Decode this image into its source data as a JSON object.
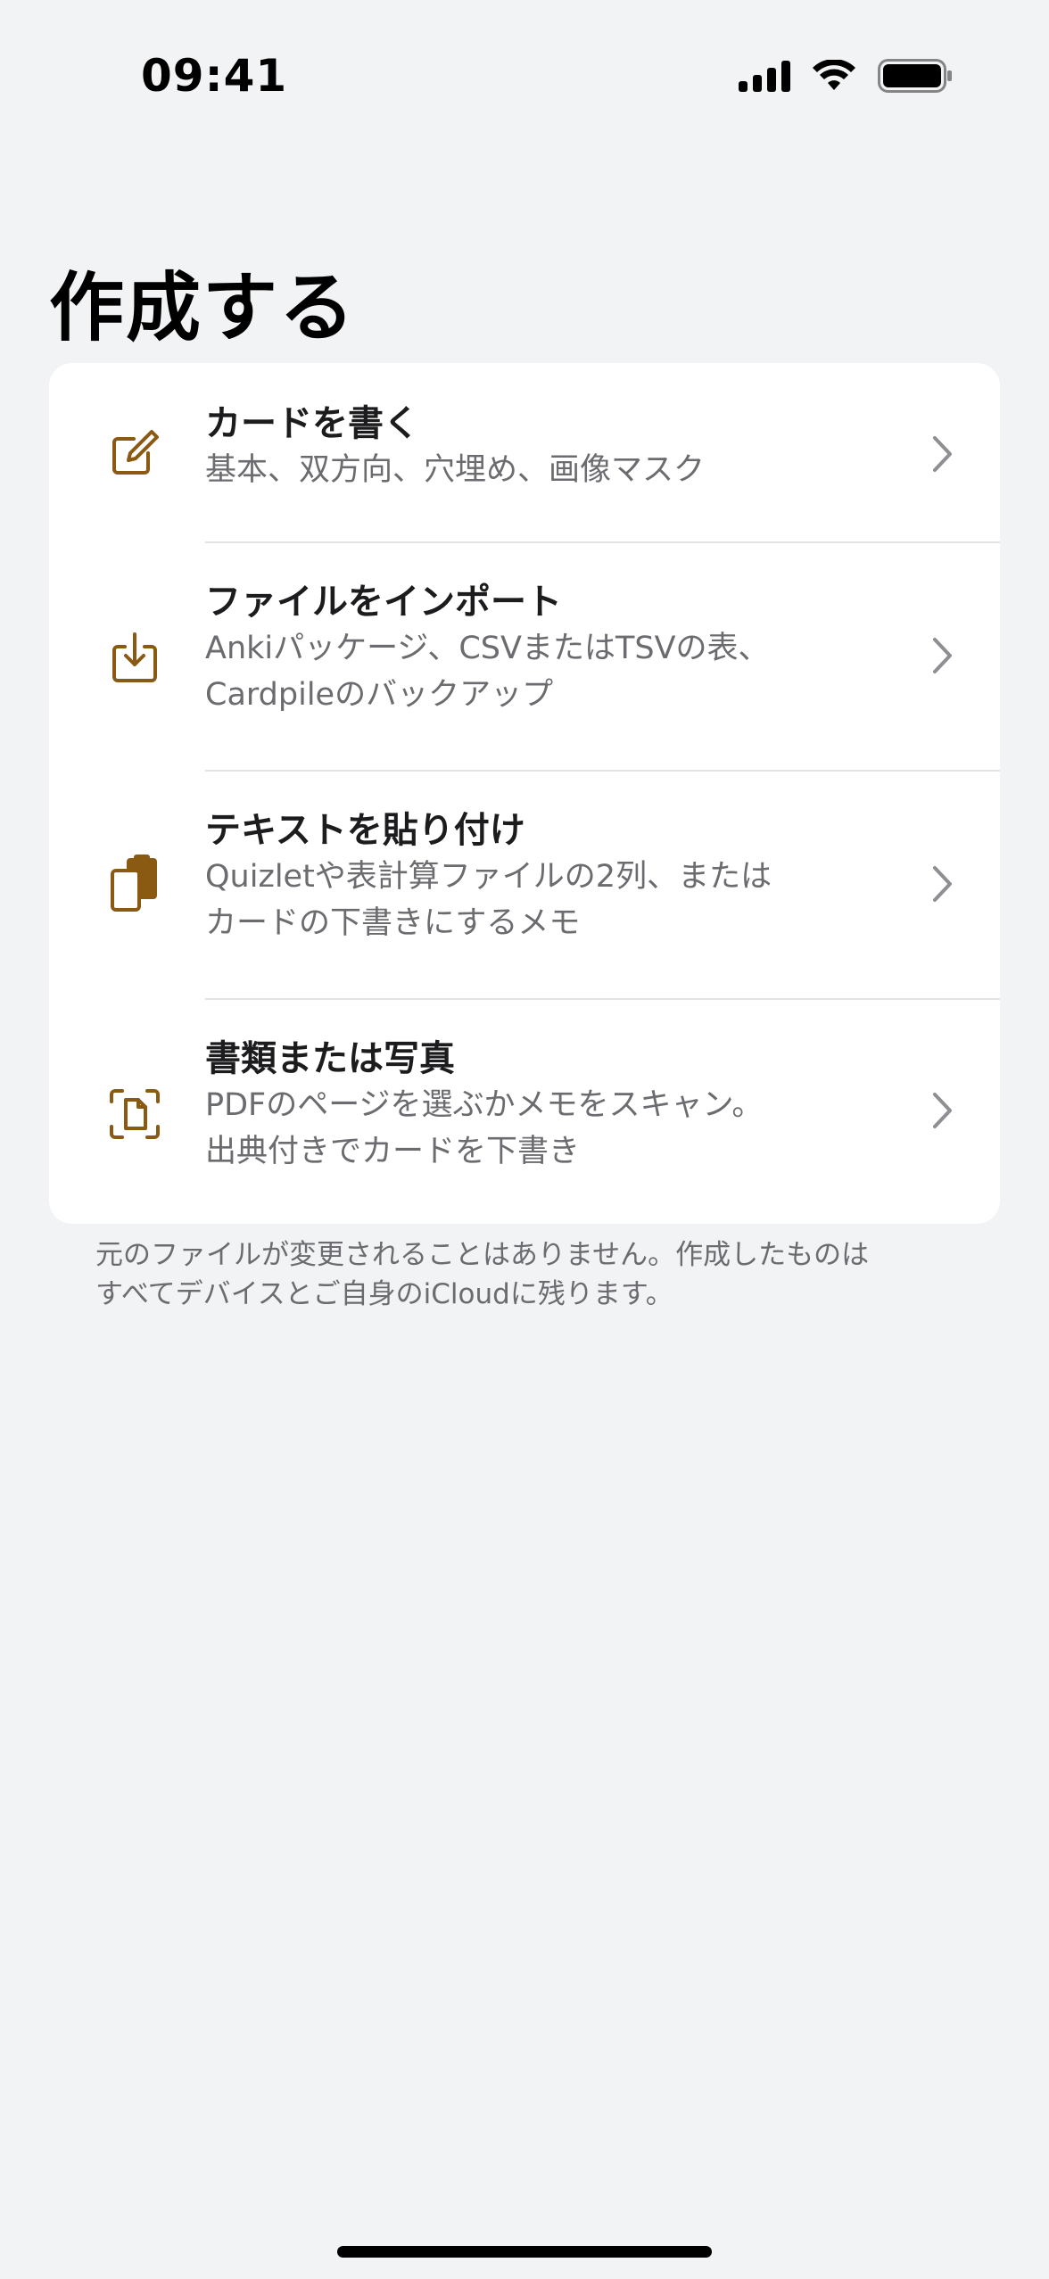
{
  "status_bar": {
    "time": "09:41"
  },
  "page": {
    "title": "作成する"
  },
  "colors": {
    "accent": "#8a5a12",
    "background": "#f2f3f5",
    "card": "#ffffff",
    "secondary_text": "#6b6b70"
  },
  "items": [
    {
      "icon": "compose-icon",
      "title": "カードを書く",
      "subtitle": "基本、双方向、穴埋め、画像マスク"
    },
    {
      "icon": "import-icon",
      "title": "ファイルをインポート",
      "subtitle": "Ankiパッケージ、CSVまたはTSVの表、\nCardpileのバックアップ"
    },
    {
      "icon": "paste-icon",
      "title": "テキストを貼り付け",
      "subtitle": "Quizletや表計算ファイルの2列、または\nカードの下書きにするメモ"
    },
    {
      "icon": "document-scan-icon",
      "title": "書類または写真",
      "subtitle": "PDFのページを選ぶかメモをスキャン。\n出典付きでカードを下書き"
    }
  ],
  "footer": {
    "note": "元のファイルが変更されることはありません。作成したものは\nすべてデバイスとご自身のiCloudに残ります。"
  }
}
